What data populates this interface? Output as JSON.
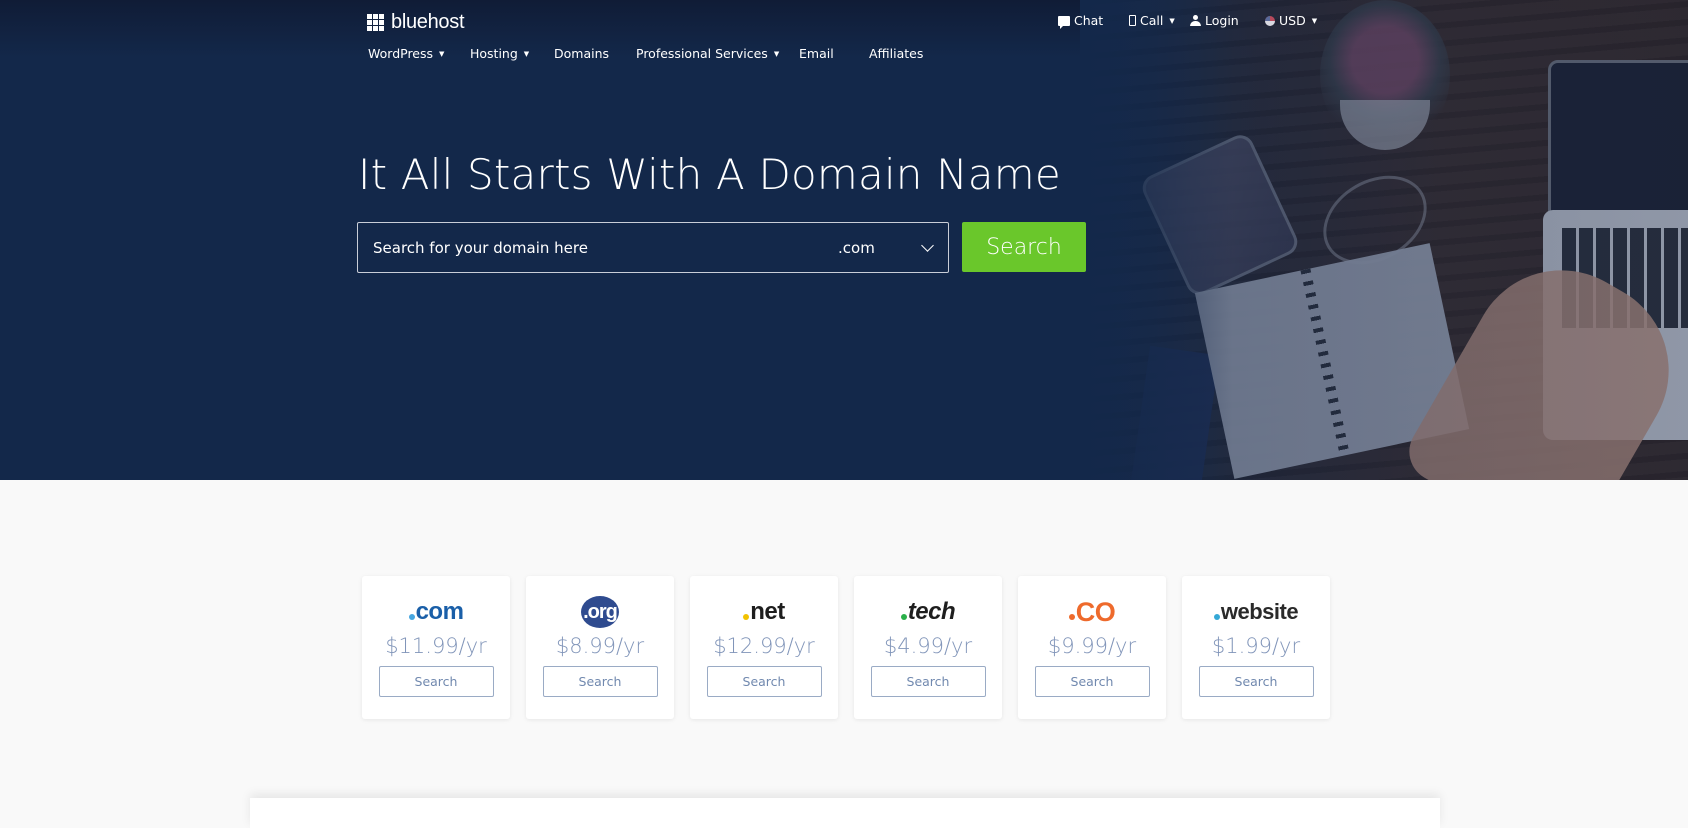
{
  "brand": {
    "name": "bluehost",
    "logo_icon": "grid-icon"
  },
  "nav": [
    {
      "label": "WordPress",
      "dropdown": true
    },
    {
      "label": "Hosting",
      "dropdown": true
    },
    {
      "label": "Domains",
      "dropdown": false
    },
    {
      "label": "Professional Services",
      "dropdown": true
    },
    {
      "label": "Email",
      "dropdown": false
    },
    {
      "label": "Affiliates",
      "dropdown": false
    }
  ],
  "utility": {
    "chat": {
      "label": "Chat",
      "icon": "chat-icon"
    },
    "call": {
      "label": "Call",
      "icon": "phone-icon",
      "dropdown": true
    },
    "login": {
      "label": "Login",
      "icon": "user-icon"
    },
    "currency": {
      "label": "USD",
      "icon": "us-flag-icon",
      "dropdown": true
    }
  },
  "hero": {
    "headline": "It All Starts With A Domain Name",
    "search_placeholder": "Search for your domain here",
    "search_value": "",
    "tld_selected": ".com",
    "search_button": "Search"
  },
  "tlds": [
    {
      "name": "com",
      "price": "$11.99/yr",
      "button": "Search",
      "color": "#1a5fa8",
      "dot_color": "#46a6e0"
    },
    {
      "name": "org",
      "price": "$8.99/yr",
      "button": "Search",
      "color": "#2f4b8f",
      "dot_color": "#ffffff"
    },
    {
      "name": "net",
      "price": "$12.99/yr",
      "button": "Search",
      "color": "#1e1e1e",
      "dot_color": "#f2c200"
    },
    {
      "name": "tech",
      "price": "$4.99/yr",
      "button": "Search",
      "color": "#1e1e1e",
      "dot_color": "#2bb04a"
    },
    {
      "name": "co",
      "price": "$9.99/yr",
      "button": "Search",
      "color": "#ee6a2c",
      "dot_color": "#ee6a2c"
    },
    {
      "name": "website",
      "price": "$1.99/yr",
      "button": "Search",
      "color": "#2a2a2a",
      "dot_color": "#35a8d6"
    }
  ],
  "colors": {
    "hero_bg": "#13284a",
    "accent_green": "#6ac72b",
    "price_text": "#8195b9"
  }
}
